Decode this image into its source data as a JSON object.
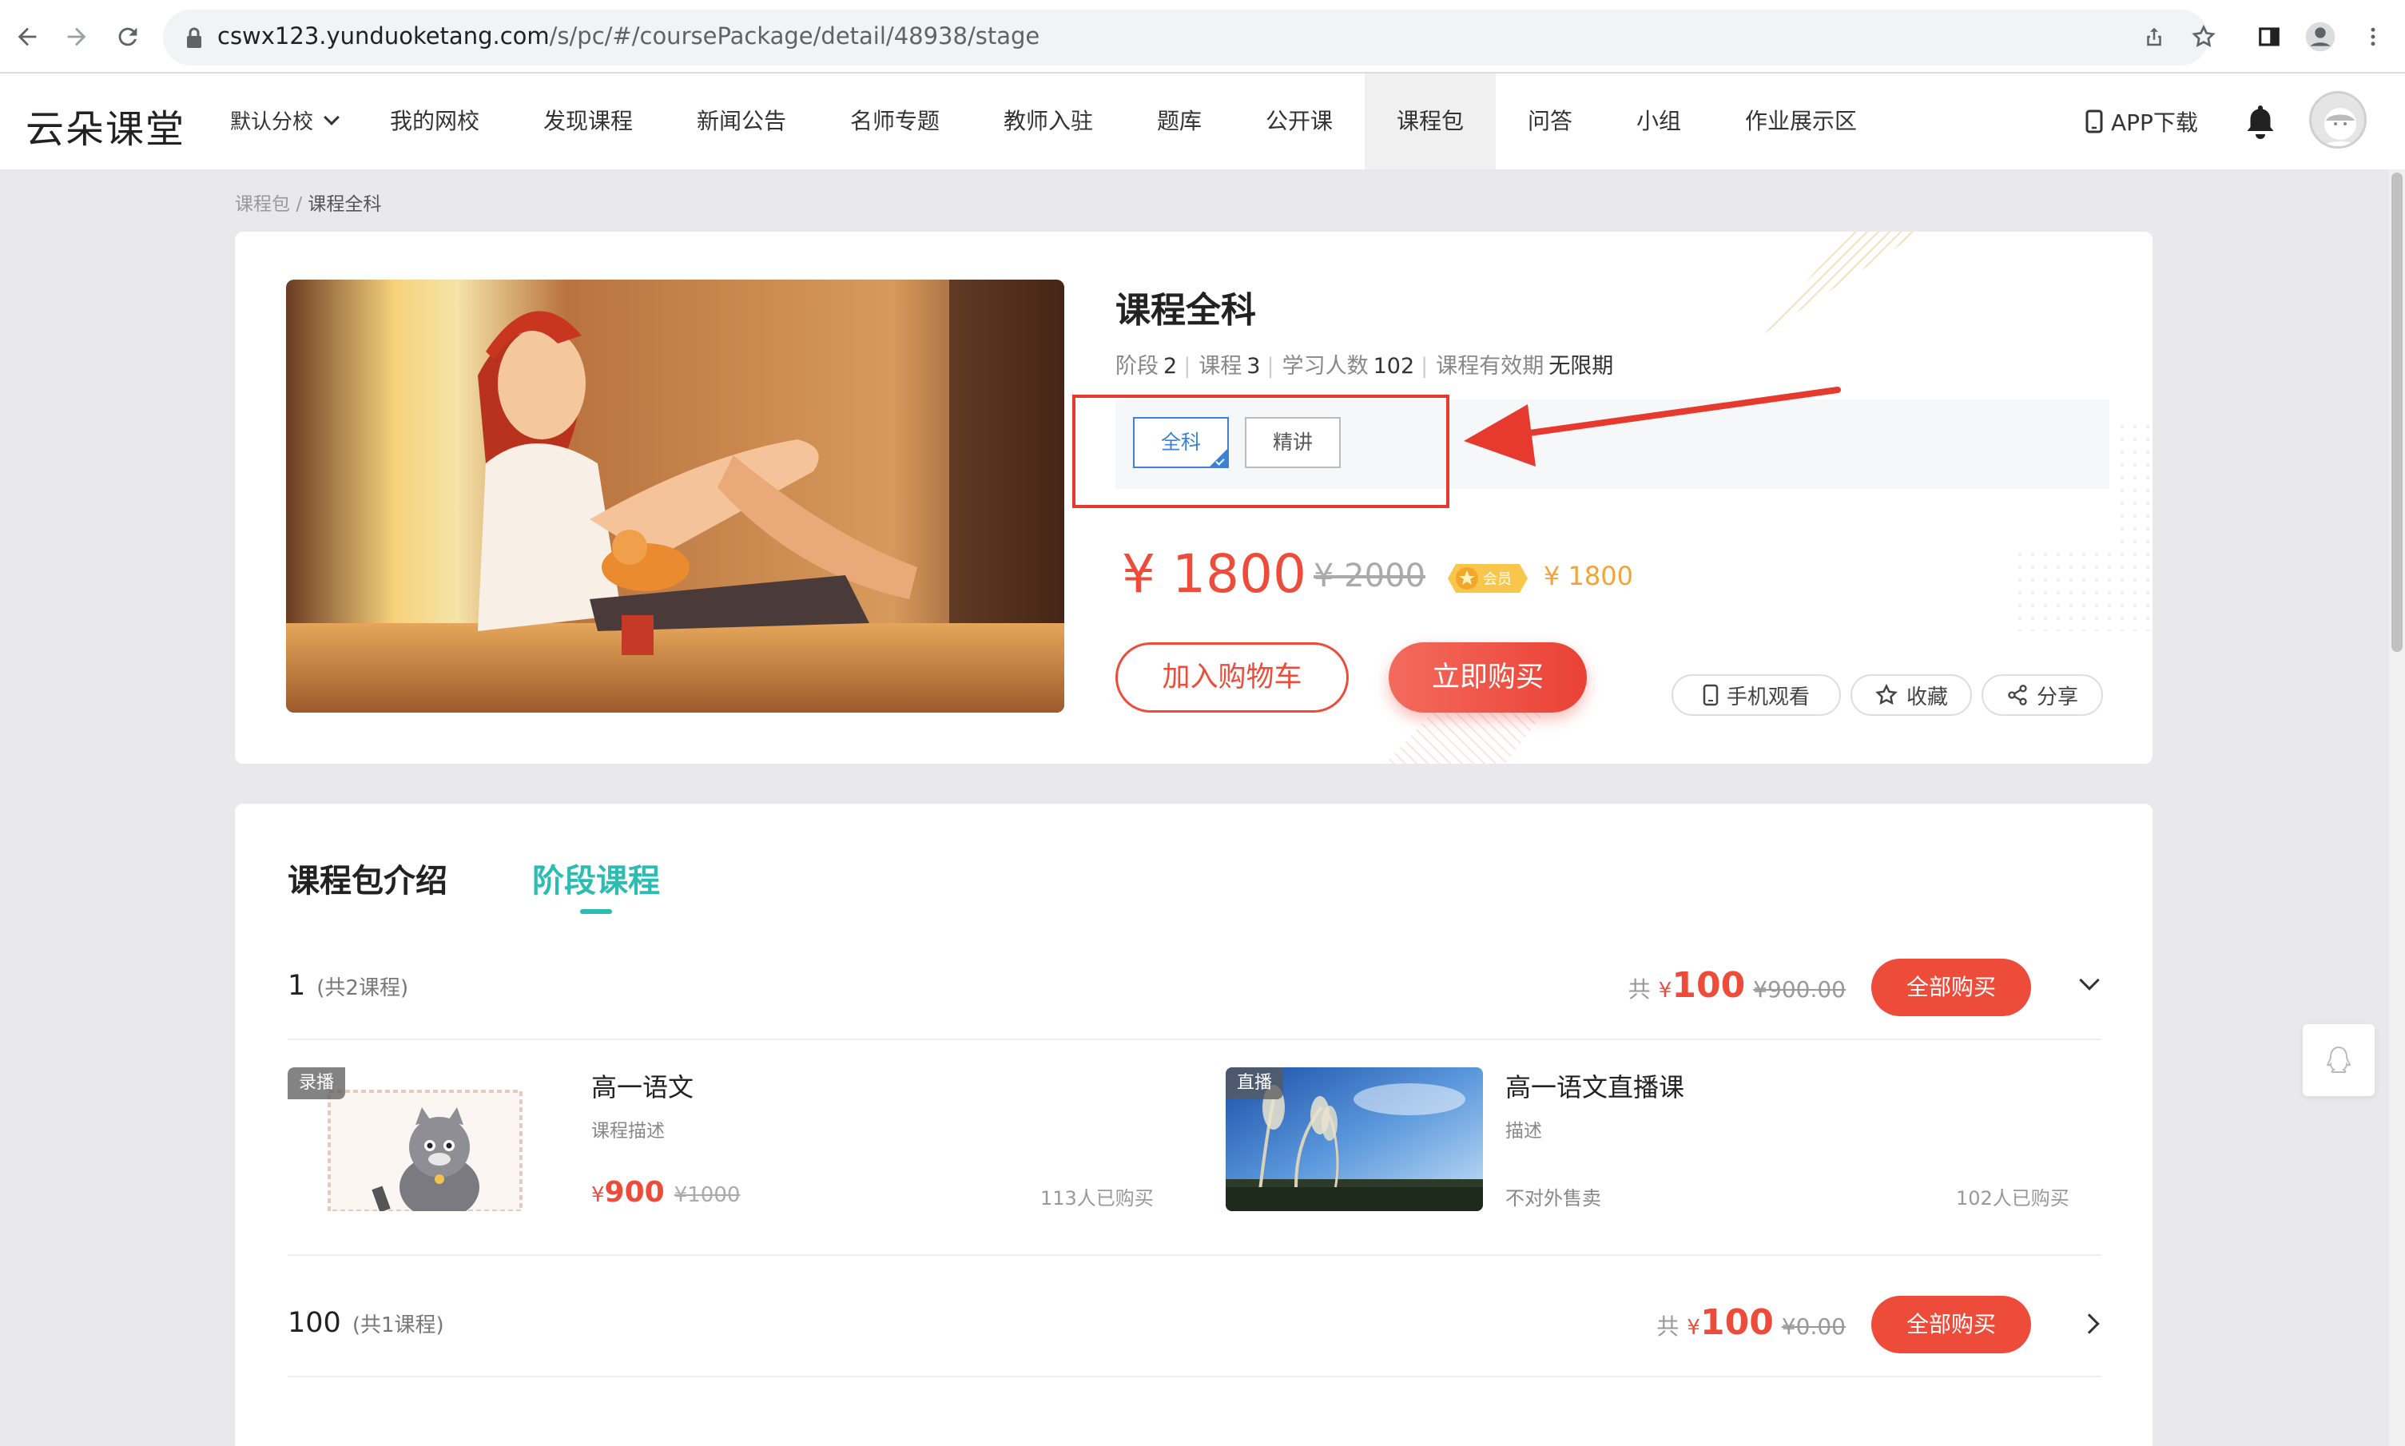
{
  "browser": {
    "url_host": "cswx123.yunduoketang.com",
    "url_path": "/s/pc/#/coursePackage/detail/48938/stage",
    "icons": [
      "back-icon",
      "forward-icon",
      "reload-icon",
      "lock-icon",
      "share-icon",
      "star-icon",
      "sidepanel-icon",
      "profile-icon",
      "menu-icon"
    ]
  },
  "header": {
    "logo": "云朵课堂",
    "branch": "默认分校",
    "nav": [
      "我的网校",
      "发现课程",
      "新闻公告",
      "名师专题",
      "教师入驻",
      "题库",
      "公开课",
      "课程包",
      "问答",
      "小组",
      "作业展示区"
    ],
    "active_nav": "课程包",
    "app_download": "APP下载"
  },
  "breadcrumb": {
    "parent": "课程包",
    "sep": "/",
    "current": "课程全科"
  },
  "course": {
    "title": "课程全科",
    "meta": {
      "stage_label": "阶段",
      "stage_value": "2",
      "course_label": "课程",
      "course_value": "3",
      "learners_label": "学习人数",
      "learners_value": "102",
      "validity_label": "课程有效期",
      "validity_value": "无限期",
      "sep": "|"
    },
    "stage_tags": [
      {
        "label": "全科",
        "selected": true
      },
      {
        "label": "精讲",
        "selected": false
      }
    ],
    "price": "¥ 1800",
    "old_price": "¥ 2000",
    "member_badge": "会员",
    "member_price": "¥ 1800",
    "add_cart": "加入购物车",
    "buy_now": "立即购买",
    "mobile_watch": "手机观看",
    "favorite": "收藏",
    "share": "分享"
  },
  "tabs": {
    "intro": "课程包介绍",
    "stages": "阶段课程",
    "active": "阶段课程"
  },
  "stages": [
    {
      "name": "1",
      "count": "(共2课程)",
      "total_prefix": "共",
      "currency": "¥",
      "total": "100",
      "total_old": "¥900.00",
      "buy_all": "全部购买",
      "expanded": true,
      "courses": [
        {
          "tag": "录播",
          "title": "高一语文",
          "desc": "课程描述",
          "price_currency": "¥",
          "price": "900",
          "old_price": "¥1000",
          "sold": "113人已购买"
        },
        {
          "tag": "直播",
          "title": "高一语文直播课",
          "desc": "描述",
          "status": "不对外售卖",
          "sold": "102人已购买"
        }
      ]
    },
    {
      "name": "100",
      "count": "(共1课程)",
      "total_prefix": "共",
      "currency": "¥",
      "total": "100",
      "total_old": "¥0.00",
      "buy_all": "全部购买",
      "expanded": false
    }
  ],
  "colors": {
    "accent_red": "#ee4c3b",
    "teal": "#2bbcb2",
    "select_blue": "#3b82d6",
    "gold": "#f2a43a",
    "annotation_red": "#e63a2e"
  }
}
